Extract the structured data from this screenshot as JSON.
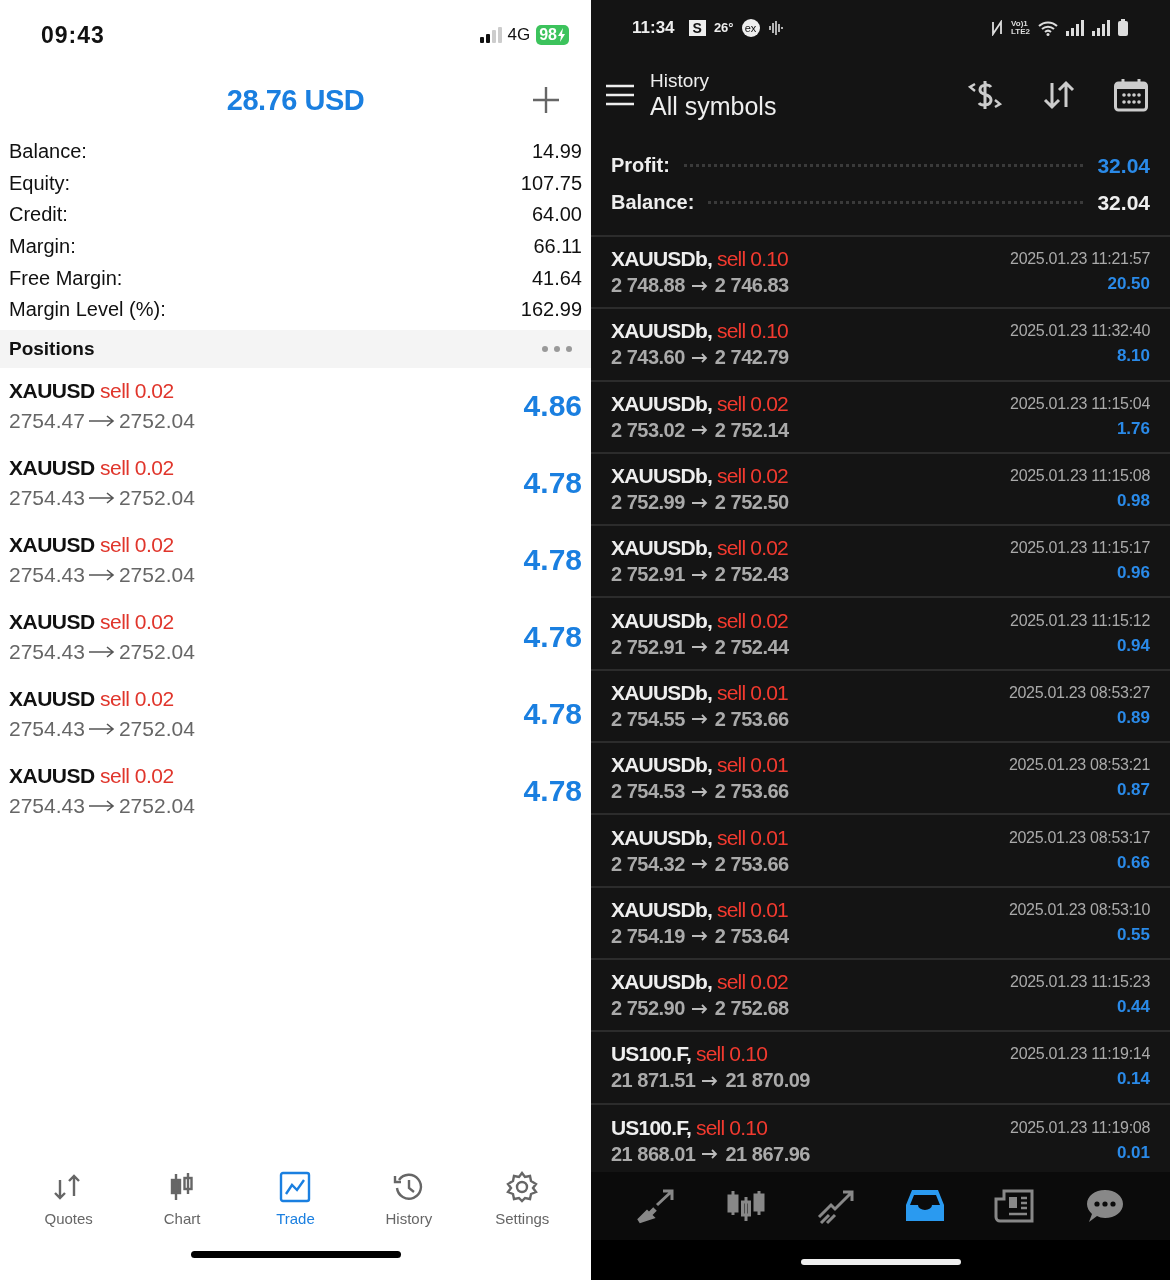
{
  "left": {
    "status_bar": {
      "time": "09:43",
      "network": "4G",
      "battery": "98"
    },
    "header": {
      "title": "28.76 USD"
    },
    "summary": [
      {
        "label": "Balance:",
        "value": "14.99"
      },
      {
        "label": "Equity:",
        "value": "107.75"
      },
      {
        "label": "Credit:",
        "value": "64.00"
      },
      {
        "label": "Margin:",
        "value": "66.11"
      },
      {
        "label": "Free Margin:",
        "value": "41.64"
      },
      {
        "label": "Margin Level (%):",
        "value": "162.99"
      }
    ],
    "positions": {
      "title": "Positions",
      "items": [
        {
          "symbol": "XAUUSD",
          "side": "sell",
          "volume": "0.02",
          "open": "2754.47",
          "current": "2752.04",
          "profit": "4.86"
        },
        {
          "symbol": "XAUUSD",
          "side": "sell",
          "volume": "0.02",
          "open": "2754.43",
          "current": "2752.04",
          "profit": "4.78"
        },
        {
          "symbol": "XAUUSD",
          "side": "sell",
          "volume": "0.02",
          "open": "2754.43",
          "current": "2752.04",
          "profit": "4.78"
        },
        {
          "symbol": "XAUUSD",
          "side": "sell",
          "volume": "0.02",
          "open": "2754.43",
          "current": "2752.04",
          "profit": "4.78"
        },
        {
          "symbol": "XAUUSD",
          "side": "sell",
          "volume": "0.02",
          "open": "2754.43",
          "current": "2752.04",
          "profit": "4.78"
        },
        {
          "symbol": "XAUUSD",
          "side": "sell",
          "volume": "0.02",
          "open": "2754.43",
          "current": "2752.04",
          "profit": "4.78"
        }
      ]
    },
    "tab_bar": [
      {
        "label": "Quotes",
        "selected": false
      },
      {
        "label": "Chart",
        "selected": false
      },
      {
        "label": "Trade",
        "selected": true
      },
      {
        "label": "History",
        "selected": false
      },
      {
        "label": "Settings",
        "selected": false
      }
    ]
  },
  "right": {
    "status_bar": {
      "time": "11:34",
      "app_badge": "S",
      "temperature": "26°",
      "app_icon": "ex",
      "volte": "Vo)1",
      "lte": "LTE2"
    },
    "header": {
      "title": "History",
      "subtitle": "All symbols"
    },
    "totals": [
      {
        "label": "Profit:",
        "value": "32.04",
        "kind": "profit"
      },
      {
        "label": "Balance:",
        "value": "32.04",
        "kind": "balance"
      }
    ],
    "deals": [
      {
        "symbol": "XAUUSDb,",
        "side": "sell",
        "volume": "0.10",
        "open": "2 748.88",
        "close": "2 746.83",
        "time": "2025.01.23 11:21:57",
        "profit": "20.50"
      },
      {
        "symbol": "XAUUSDb,",
        "side": "sell",
        "volume": "0.10",
        "open": "2 743.60",
        "close": "2 742.79",
        "time": "2025.01.23 11:32:40",
        "profit": "8.10"
      },
      {
        "symbol": "XAUUSDb,",
        "side": "sell",
        "volume": "0.02",
        "open": "2 753.02",
        "close": "2 752.14",
        "time": "2025.01.23 11:15:04",
        "profit": "1.76"
      },
      {
        "symbol": "XAUUSDb,",
        "side": "sell",
        "volume": "0.02",
        "open": "2 752.99",
        "close": "2 752.50",
        "time": "2025.01.23 11:15:08",
        "profit": "0.98"
      },
      {
        "symbol": "XAUUSDb,",
        "side": "sell",
        "volume": "0.02",
        "open": "2 752.91",
        "close": "2 752.43",
        "time": "2025.01.23 11:15:17",
        "profit": "0.96"
      },
      {
        "symbol": "XAUUSDb,",
        "side": "sell",
        "volume": "0.02",
        "open": "2 752.91",
        "close": "2 752.44",
        "time": "2025.01.23 11:15:12",
        "profit": "0.94"
      },
      {
        "symbol": "XAUUSDb,",
        "side": "sell",
        "volume": "0.01",
        "open": "2 754.55",
        "close": "2 753.66",
        "time": "2025.01.23 08:53:27",
        "profit": "0.89"
      },
      {
        "symbol": "XAUUSDb,",
        "side": "sell",
        "volume": "0.01",
        "open": "2 754.53",
        "close": "2 753.66",
        "time": "2025.01.23 08:53:21",
        "profit": "0.87"
      },
      {
        "symbol": "XAUUSDb,",
        "side": "sell",
        "volume": "0.01",
        "open": "2 754.32",
        "close": "2 753.66",
        "time": "2025.01.23 08:53:17",
        "profit": "0.66"
      },
      {
        "symbol": "XAUUSDb,",
        "side": "sell",
        "volume": "0.01",
        "open": "2 754.19",
        "close": "2 753.64",
        "time": "2025.01.23 08:53:10",
        "profit": "0.55"
      },
      {
        "symbol": "XAUUSDb,",
        "side": "sell",
        "volume": "0.02",
        "open": "2 752.90",
        "close": "2 752.68",
        "time": "2025.01.23 11:15:23",
        "profit": "0.44"
      },
      {
        "symbol": "US100.F,",
        "side": "sell",
        "volume": "0.10",
        "open": "21 871.51",
        "close": "21 870.09",
        "time": "2025.01.23 11:19:14",
        "profit": "0.14"
      },
      {
        "symbol": "US100.F,",
        "side": "sell",
        "volume": "0.10",
        "open": "21 868.01",
        "close": "21 867.96",
        "time": "2025.01.23 11:19:08",
        "profit": "0.01"
      }
    ],
    "tab_bar": [
      {
        "selected": false
      },
      {
        "selected": false
      },
      {
        "selected": false
      },
      {
        "selected": true
      },
      {
        "selected": false
      },
      {
        "selected": false
      }
    ]
  }
}
